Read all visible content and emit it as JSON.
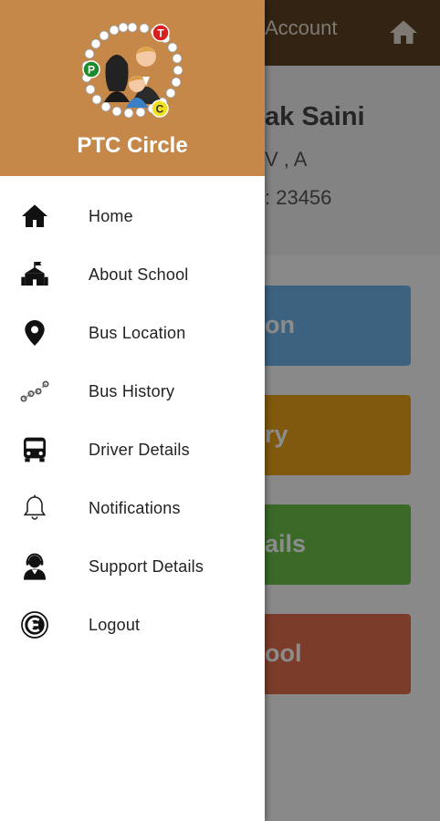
{
  "background": {
    "appbar_title": "Account",
    "profile": {
      "name": "ak Saini",
      "class": "V , A",
      "id": ": 23456"
    },
    "tiles": [
      "on",
      "ry",
      "ails",
      "ool"
    ]
  },
  "drawer": {
    "app_name": "PTC Circle",
    "logo_letters": [
      "P",
      "T",
      "C"
    ],
    "menu": [
      {
        "label": "Home",
        "icon": "home-icon"
      },
      {
        "label": "About School",
        "icon": "school-icon"
      },
      {
        "label": "Bus Location",
        "icon": "location-pin-icon"
      },
      {
        "label": "Bus History",
        "icon": "route-history-icon"
      },
      {
        "label": "Driver Details",
        "icon": "bus-icon"
      },
      {
        "label": "Notifications",
        "icon": "bell-icon"
      },
      {
        "label": "Support Details",
        "icon": "support-agent-icon"
      },
      {
        "label": "Logout",
        "icon": "logout-icon"
      }
    ]
  },
  "colors": {
    "appbar": "#5d4124",
    "drawer_header": "#c58848",
    "tile_blue": "#6fb3e8",
    "tile_orange": "#eaa31b",
    "tile_green": "#6cc048",
    "tile_red": "#e06e4d"
  }
}
